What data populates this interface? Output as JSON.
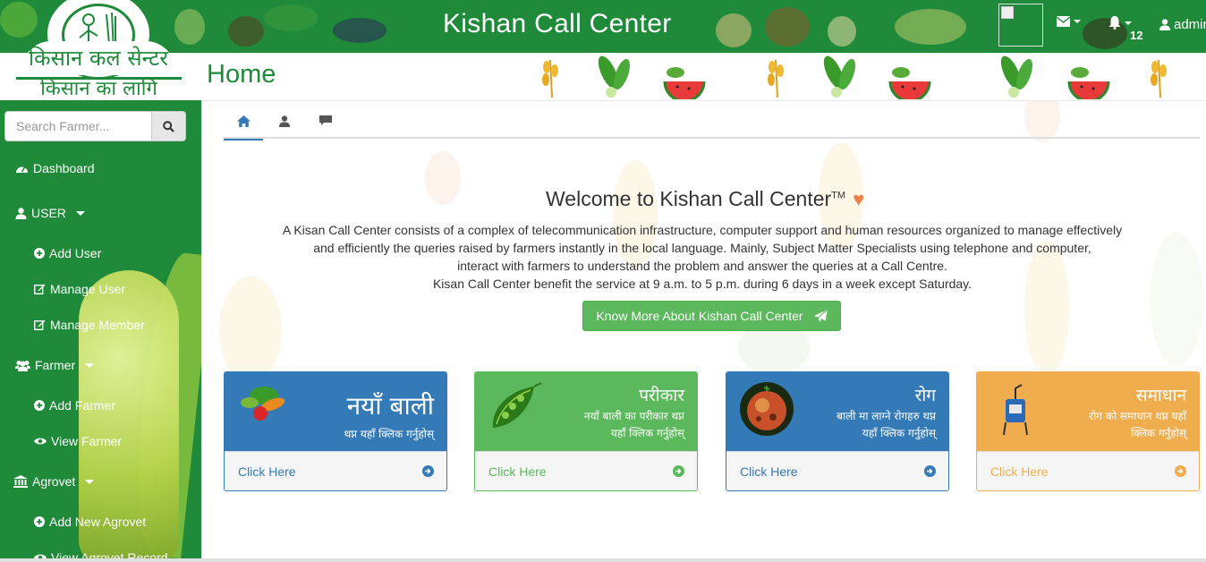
{
  "header": {
    "title": "Kishan Call Center",
    "notification_count": "12",
    "user_label": "admin",
    "icons": [
      "envelope-icon",
      "bell-icon",
      "user-icon"
    ]
  },
  "logo": {
    "arc_text": "किसान कल सेन्टर",
    "sub_text": "किसान का लागि"
  },
  "sidebar": {
    "search_placeholder": "Search Farmer...",
    "items": [
      {
        "label": "Dashboard",
        "icon": "dashboard-icon"
      },
      {
        "label": "USER",
        "icon": "user-icon",
        "dropdown": true
      },
      {
        "label": "Add User",
        "icon": "plus-circle-icon"
      },
      {
        "label": "Manage User",
        "icon": "edit-icon"
      },
      {
        "label": "Manage Member",
        "icon": "edit-icon"
      },
      {
        "label": "Farmer",
        "icon": "users-icon",
        "dropdown": true
      },
      {
        "label": "Add Farmer",
        "icon": "plus-circle-icon"
      },
      {
        "label": "View Farmer",
        "icon": "eye-icon"
      },
      {
        "label": "Agrovet",
        "icon": "bank-icon",
        "dropdown": true
      },
      {
        "label": "Add New Agrovet",
        "icon": "plus-circle-icon"
      },
      {
        "label": "View Agrovet Record",
        "icon": "eye-icon"
      }
    ]
  },
  "main": {
    "page_title": "Home",
    "tabs": [
      {
        "icon": "home-icon",
        "active": true
      },
      {
        "icon": "user-icon",
        "active": false
      },
      {
        "icon": "comment-icon",
        "active": false
      }
    ],
    "welcome_title": "Welcome to Kishan Call Center",
    "welcome_tm": "TM",
    "heart": "♥",
    "description": [
      "A Kisan Call Center consists of a complex of telecommunication infrastructure, computer support and human resources organized to manage effectively",
      "and efficiently the queries raised by farmers instantly in the local language. Mainly, Subject Matter Specialists using telephone and computer,",
      "interact with farmers to understand the problem and answer the queries at a Call Centre.",
      "Kisan Call Center benefit the service at 9 a.m. to 5 p.m. during 6 days in a week except Saturday."
    ],
    "cta_label": "Know More About Kishan Call Center",
    "cards": [
      {
        "title": "नयाँ बाली",
        "subtitle_lines": [
          "थप्न यहाँ क्लिक गर्नुहोस्"
        ],
        "link": "Click Here",
        "color": "#337ab7",
        "icon": "vegetables-icon"
      },
      {
        "title": "परीकार",
        "subtitle_lines": [
          "नयाँ बाली का परीकार थप्न",
          "यहाँ क्लिक गर्नुहोस्"
        ],
        "link": "Click Here",
        "color": "#5cb85c",
        "icon": "peas-icon"
      },
      {
        "title": "रोग",
        "subtitle_lines": [
          "बाली मा लाग्ने रोगहरु थप्न",
          "यहाँ क्लिक गर्नुहोस्"
        ],
        "link": "Click Here",
        "color": "#337ab7",
        "icon": "diseased-fruit-icon"
      },
      {
        "title": "समाधान",
        "subtitle_lines": [
          "रोग को समाधान थप्न यहाँ",
          "क्लिक गर्नुहोस्"
        ],
        "link": "Click Here",
        "color": "#f0ad4e",
        "icon": "sprayer-icon"
      }
    ]
  }
}
